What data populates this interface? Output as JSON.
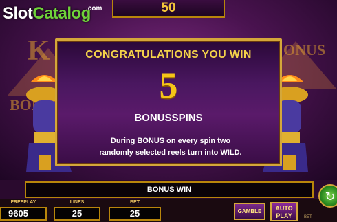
{
  "top_counter": "50",
  "watermark": {
    "slot": "Slot",
    "catalog": "Catalog",
    "com": ".com"
  },
  "popup": {
    "title": "CONGRATULATIONS YOU WIN",
    "number": "5",
    "subtitle": "BONUSSPINS",
    "desc_line1": "During BONUS on every spin two",
    "desc_line2": "randomly selected reels turn into WILD."
  },
  "reel_fragments": {
    "k": "K",
    "onus": "ONUS",
    "bon": "BON"
  },
  "bonus_bar": "BONUS WIN",
  "fields": {
    "freeplay": {
      "label": "FREEPLAY",
      "value": "9605"
    },
    "lines": {
      "label": "LINES",
      "value": "25"
    },
    "bet": {
      "label": "BET",
      "value": "25"
    }
  },
  "buttons": {
    "gamble": "GAMBLE",
    "auto": "AUTO",
    "play": "PLAY",
    "bet_small": "BET"
  },
  "colors": {
    "gold": "#f5c518",
    "frame": "#d4a73a",
    "spin_green": "#2a8a20"
  }
}
